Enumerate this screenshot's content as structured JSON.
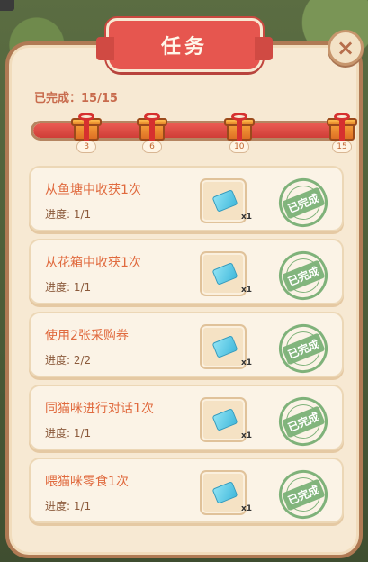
{
  "title": "任务",
  "close": {
    "label": "×"
  },
  "summary": {
    "label": "已完成：",
    "value": "15/15"
  },
  "progress": {
    "fraction": 1.0
  },
  "milestones": [
    {
      "value": "3",
      "position": 0.18
    },
    {
      "value": "6",
      "position": 0.39
    },
    {
      "value": "10",
      "position": 0.67
    },
    {
      "value": "15",
      "position": 1.0
    }
  ],
  "tasks": [
    {
      "title": "从鱼塘中收获1次",
      "progress": "进度: 1/1",
      "reward_qty": "x1",
      "status": "已完成"
    },
    {
      "title": "从花箱中收获1次",
      "progress": "进度: 1/1",
      "reward_qty": "x1",
      "status": "已完成"
    },
    {
      "title": "使用2张采购券",
      "progress": "进度: 2/2",
      "reward_qty": "x1",
      "status": "已完成"
    },
    {
      "title": "同猫咪进行对话1次",
      "progress": "进度: 1/1",
      "reward_qty": "x1",
      "status": "已完成"
    },
    {
      "title": "喂猫咪零食1次",
      "progress": "进度: 1/1",
      "reward_qty": "x1",
      "status": "已完成"
    }
  ],
  "icons": {
    "reward": "ticket-icon",
    "milestone": "gift-box-icon",
    "close": "close-icon"
  },
  "colors": {
    "banner": "#e6564f",
    "progress": "#d9433d",
    "stamp": "#82b57d",
    "panel": "#f7e9d3"
  }
}
